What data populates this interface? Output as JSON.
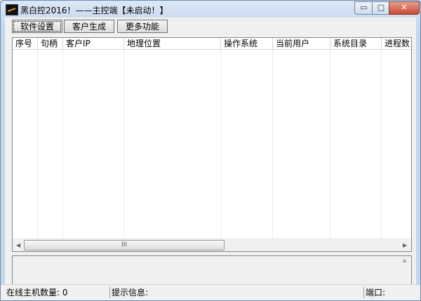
{
  "window": {
    "title": "黑白控2016！——主控端【未启动！】",
    "controls": {
      "minimize": "▭",
      "maximize": "□",
      "close": "✕"
    }
  },
  "toolbar": {
    "software_settings": "软件设置",
    "client_generate": "客户生成",
    "more_functions": "更多功能"
  },
  "grid": {
    "columns": [
      "序号",
      "句柄",
      "客户IP",
      "地理位置",
      "操作系统",
      "当前用户",
      "系统目录",
      "进程数"
    ],
    "rows": []
  },
  "scrollbar": {
    "left_arrow": "◀",
    "right_arrow": "▶",
    "thumb_grip": "III",
    "up_arrow": "▲",
    "down_arrow": "▼"
  },
  "status": {
    "online_hosts": "在线主机数量: 0",
    "hint": "提示信息:",
    "port": "端口:"
  }
}
